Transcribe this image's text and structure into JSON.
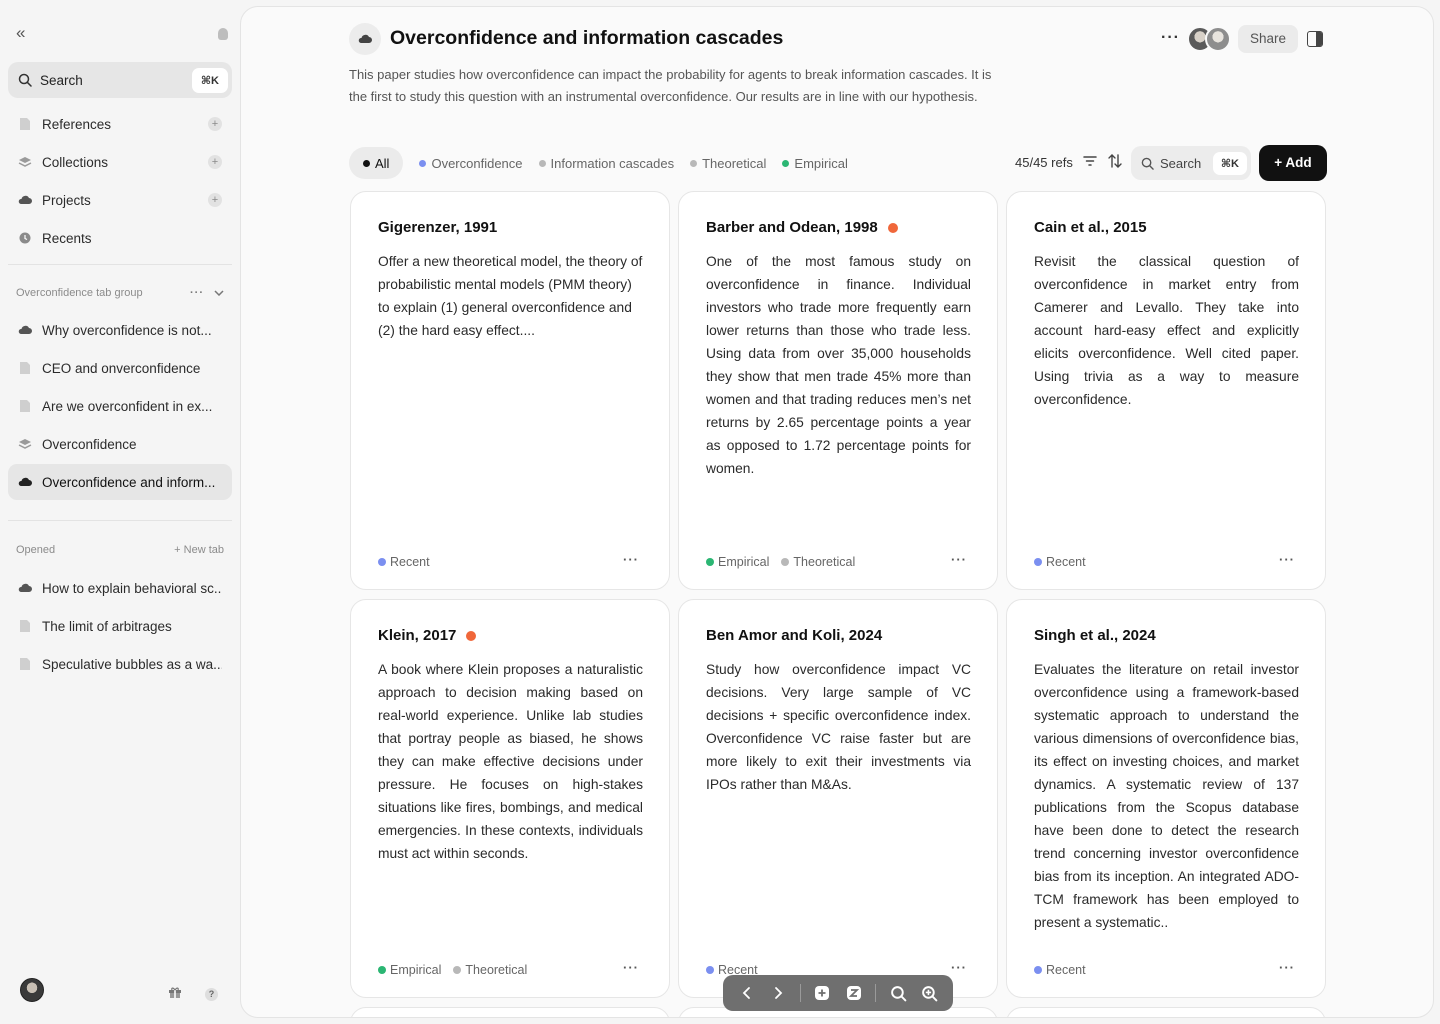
{
  "sidebar": {
    "search_label": "Search",
    "search_shortcut": "⌘K",
    "nav": [
      {
        "label": "References"
      },
      {
        "label": "Collections"
      },
      {
        "label": "Projects"
      },
      {
        "label": "Recents"
      }
    ],
    "tab_group": {
      "title": "Overconfidence tab group",
      "items": [
        {
          "label": "Why overconfidence is not..."
        },
        {
          "label": "CEO and onverconfidence"
        },
        {
          "label": "Are we overconfident in ex..."
        },
        {
          "label": "Overconfidence"
        },
        {
          "label": "Overconfidence and inform..."
        }
      ]
    },
    "opened": {
      "title": "Opened",
      "new_tab": "+ New tab",
      "items": [
        {
          "label": "How to explain behavioral sc..."
        },
        {
          "label": "The limit of arbitrages"
        },
        {
          "label": "Speculative bubbles as a wa..."
        }
      ]
    },
    "help": "?"
  },
  "header": {
    "title": "Overconfidence and information cascades",
    "description": "This paper studies how overconfidence can impact the probability for agents to break information cascades. It is the first to study this question with an instrumental overconfidence. Our results are in line with our hypothesis.",
    "share_label": "Share"
  },
  "filters": {
    "chips": [
      {
        "label": "All",
        "color": "#111111"
      },
      {
        "label": "Overconfidence",
        "color": "#7b8ff0"
      },
      {
        "label": "Information cascades",
        "color": "#b8b8b8"
      },
      {
        "label": "Theoretical",
        "color": "#b8b8b8"
      },
      {
        "label": "Empirical",
        "color": "#2bb673"
      }
    ],
    "refs_count": "45/45 refs",
    "search_label": "Search",
    "search_shortcut": "⌘K",
    "add_label": "+ Add"
  },
  "colors": {
    "accent_dot": "#f0673a",
    "recent": "#7b8ff0",
    "empirical": "#2bb673",
    "theoretical": "#b8b8b8"
  },
  "cards": [
    {
      "title": "Gigerenzer, 1991",
      "body": "Offer a new theoretical model, the theory of probabilistic mental models (PMM theory) to explain (1) general overconfidence and (2) the hard easy effect....",
      "tag1": "Recent",
      "tag2": ""
    },
    {
      "title": "Barber and Odean, 1998",
      "body": "One of the most famous study on overconfidence in finance. Individual investors who trade more frequently earn lower returns than those who trade less. Using data from over 35,000 households they show that men trade 45% more than women and that trading reduces men’s net returns by 2.65 percentage points a year as opposed to 1.72 percentage points for women.",
      "tag1": "Empirical",
      "tag2": "Theoretical"
    },
    {
      "title": "Cain et al., 2015",
      "body": "Revisit the classical question of overconfidence in market entry from Camerer and Levallo.  They take into account hard-easy effect and explicitly elicits overconfidence. Well cited paper. Using trivia as a way to measure overconfidence.",
      "tag1": "Recent",
      "tag2": ""
    },
    {
      "title": "Klein, 2017",
      "body": "A book where Klein proposes a naturalistic approach to decision making based on real-world experience. Unlike lab studies that portray people as biased, he shows they can make effective decisions under pressure.  He focuses on high-stakes situations like fires, bombings, and medical emergencies.  In these contexts, individuals must act within seconds.",
      "tag1": "Empirical",
      "tag2": "Theoretical"
    },
    {
      "title": "Ben Amor and Koli, 2024",
      "body": "Study how overconfidence impact VC decisions. Very large sample of VC decisions  + specific overconfidence index. Overconfidence VC raise faster but are more likely to exit their investments via IPOs rather than M&As.",
      "tag1": "Recent",
      "tag2": ""
    },
    {
      "title": "Singh et al., 2024",
      "body": "Evaluates the literature on retail investor overconfidence using a framework-based systematic approach to understand the various dimensions of overconfidence bias, its effect on investing choices, and market dynamics. A systematic review of 137 publications from the Scopus database have been done to detect the research trend concerning investor overconfidence bias from its inception. An integrated ADO-TCM framework has been employed to present a systematic..",
      "tag1": "Recent",
      "tag2": ""
    }
  ]
}
